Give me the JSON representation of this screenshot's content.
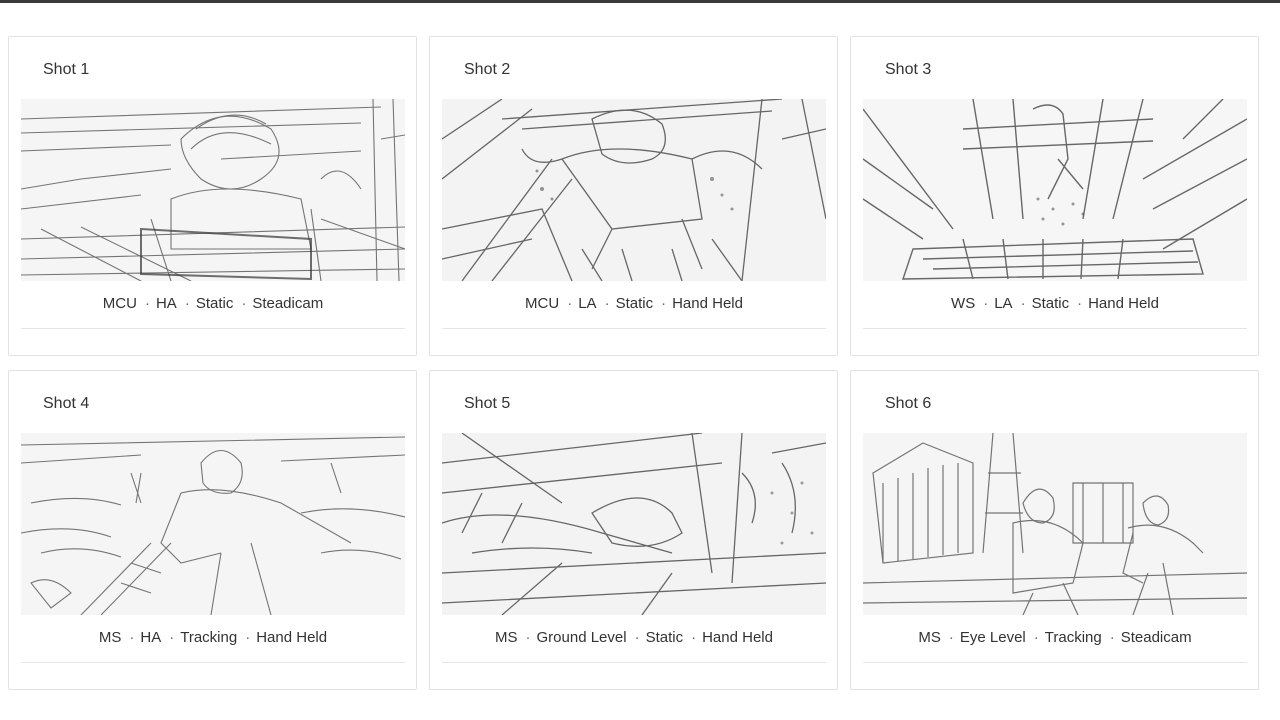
{
  "shots": [
    {
      "title": "Shot 1",
      "separator": "·",
      "specs": [
        "MCU",
        "HA",
        "Static",
        "Steadicam"
      ],
      "sketch": "storyboard-sketch-boy-on-wooden-structure-icon"
    },
    {
      "title": "Shot 2",
      "separator": "·",
      "specs": [
        "MCU",
        "LA",
        "Static",
        "Hand Held"
      ],
      "sketch": "storyboard-sketch-boy-falling-through-boards-icon"
    },
    {
      "title": "Shot 3",
      "separator": "·",
      "specs": [
        "WS",
        "LA",
        "Static",
        "Hand Held"
      ],
      "sketch": "storyboard-sketch-figure-crashing-through-floor-icon"
    },
    {
      "title": "Shot 4",
      "separator": "·",
      "specs": [
        "MS",
        "HA",
        "Tracking",
        "Hand Held"
      ],
      "sketch": "storyboard-sketch-boy-climbing-out-icon"
    },
    {
      "title": "Shot 5",
      "separator": "·",
      "specs": [
        "MS",
        "Ground Level",
        "Static",
        "Hand Held"
      ],
      "sketch": "storyboard-sketch-boy-lying-on-ground-icon"
    },
    {
      "title": "Shot 6",
      "separator": "·",
      "specs": [
        "MS",
        "Eye Level",
        "Tracking",
        "Steadicam"
      ],
      "sketch": "storyboard-sketch-men-running-from-shed-icon"
    }
  ]
}
